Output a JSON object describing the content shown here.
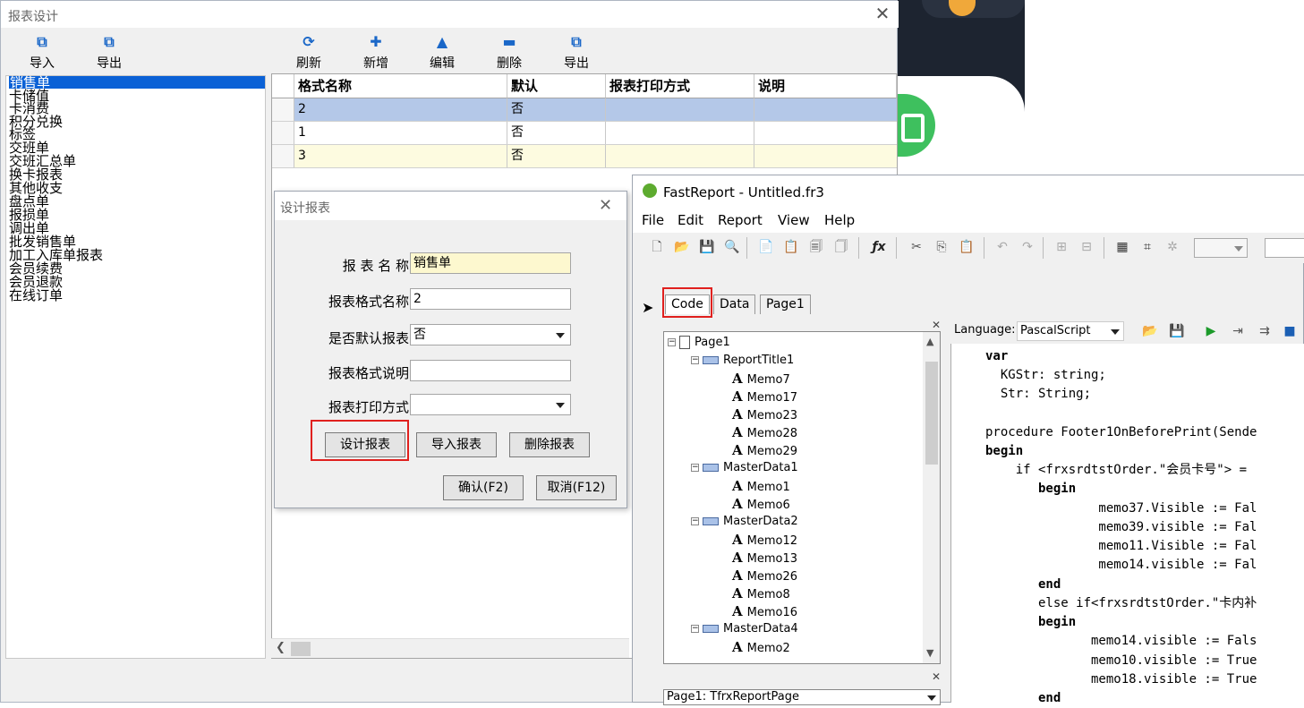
{
  "main_window": {
    "title": "报表设计",
    "left_toolbar": [
      {
        "label": "导入",
        "icon": "import-icon"
      },
      {
        "label": "导出",
        "icon": "export-icon"
      }
    ],
    "right_toolbar": [
      {
        "label": "刷新",
        "icon": "refresh-icon"
      },
      {
        "label": "新增",
        "icon": "plus-icon"
      },
      {
        "label": "编辑",
        "icon": "edit-icon"
      },
      {
        "label": "删除",
        "icon": "minus-icon"
      },
      {
        "label": "导出",
        "icon": "export-icon"
      }
    ],
    "report_list": [
      "销售单",
      "卡储值",
      "卡消费",
      "积分兑换",
      "标签",
      "交班单",
      "交班汇总单",
      "换卡报表",
      "其他收支",
      "盘点单",
      "报损单",
      "调出单",
      "批发销售单",
      "加工入库单报表",
      "会员续费",
      "会员退款",
      "在线订单"
    ],
    "grid": {
      "columns": [
        "格式名称",
        "默认",
        "报表打印方式",
        "说明"
      ],
      "rows": [
        [
          "2",
          "否",
          "",
          ""
        ],
        [
          "1",
          "否",
          "",
          ""
        ],
        [
          "3",
          "否",
          "",
          ""
        ]
      ]
    }
  },
  "dialog": {
    "title": "设计报表",
    "fields": [
      {
        "label": "报 表 名 称",
        "value": "销售单"
      },
      {
        "label": "报表格式名称",
        "value": "2"
      },
      {
        "label": "是否默认报表",
        "value": "否"
      },
      {
        "label": "报表格式说明",
        "value": ""
      },
      {
        "label": "报表打印方式",
        "value": ""
      }
    ],
    "buttons": {
      "design": "设计报表",
      "import": "导入报表",
      "delete": "删除报表",
      "ok": "确认(F2)",
      "cancel": "取消(F12)"
    }
  },
  "fastreport": {
    "title": "FastReport - Untitled.fr3",
    "menu": [
      "File",
      "Edit",
      "Report",
      "View",
      "Help"
    ],
    "tabs": [
      "Code",
      "Data",
      "Page1"
    ],
    "tree": [
      {
        "label": "Page1",
        "level": 0,
        "type": "page"
      },
      {
        "label": "ReportTitle1",
        "level": 1,
        "type": "band"
      },
      {
        "label": "Memo7",
        "level": 2,
        "type": "memo"
      },
      {
        "label": "Memo17",
        "level": 2,
        "type": "memo"
      },
      {
        "label": "Memo23",
        "level": 2,
        "type": "memo"
      },
      {
        "label": "Memo28",
        "level": 2,
        "type": "memo"
      },
      {
        "label": "Memo29",
        "level": 2,
        "type": "memo"
      },
      {
        "label": "MasterData1",
        "level": 1,
        "type": "band"
      },
      {
        "label": "Memo1",
        "level": 2,
        "type": "memo"
      },
      {
        "label": "Memo6",
        "level": 2,
        "type": "memo"
      },
      {
        "label": "MasterData2",
        "level": 1,
        "type": "band"
      },
      {
        "label": "Memo12",
        "level": 2,
        "type": "memo"
      },
      {
        "label": "Memo13",
        "level": 2,
        "type": "memo"
      },
      {
        "label": "Memo26",
        "level": 2,
        "type": "memo"
      },
      {
        "label": "Memo8",
        "level": 2,
        "type": "memo"
      },
      {
        "label": "Memo16",
        "level": 2,
        "type": "memo"
      },
      {
        "label": "MasterData4",
        "level": 1,
        "type": "band"
      },
      {
        "label": "Memo2",
        "level": 2,
        "type": "memo"
      }
    ],
    "language_label": "Language:",
    "language_value": "PascalScript",
    "object_selector": "Page1: TfrxReportPage",
    "code_lines": [
      "var",
      "  KGStr: string;",
      "  Str: String;",
      "",
      "procedure Footer1OnBeforePrint(Sende",
      "begin",
      "    if <frxsrdtstOrder.\"会员卡号\"> =",
      "       begin",
      "               memo37.Visible := Fal",
      "               memo39.visible := Fal",
      "               memo11.Visible := Fal",
      "               memo14.visible := Fal",
      "       end",
      "       else if<frxsrdtstOrder.\"卡内补",
      "       begin",
      "              memo14.visible := Fals",
      "              memo10.visible := True",
      "              memo18.visible := True",
      "       end"
    ]
  }
}
